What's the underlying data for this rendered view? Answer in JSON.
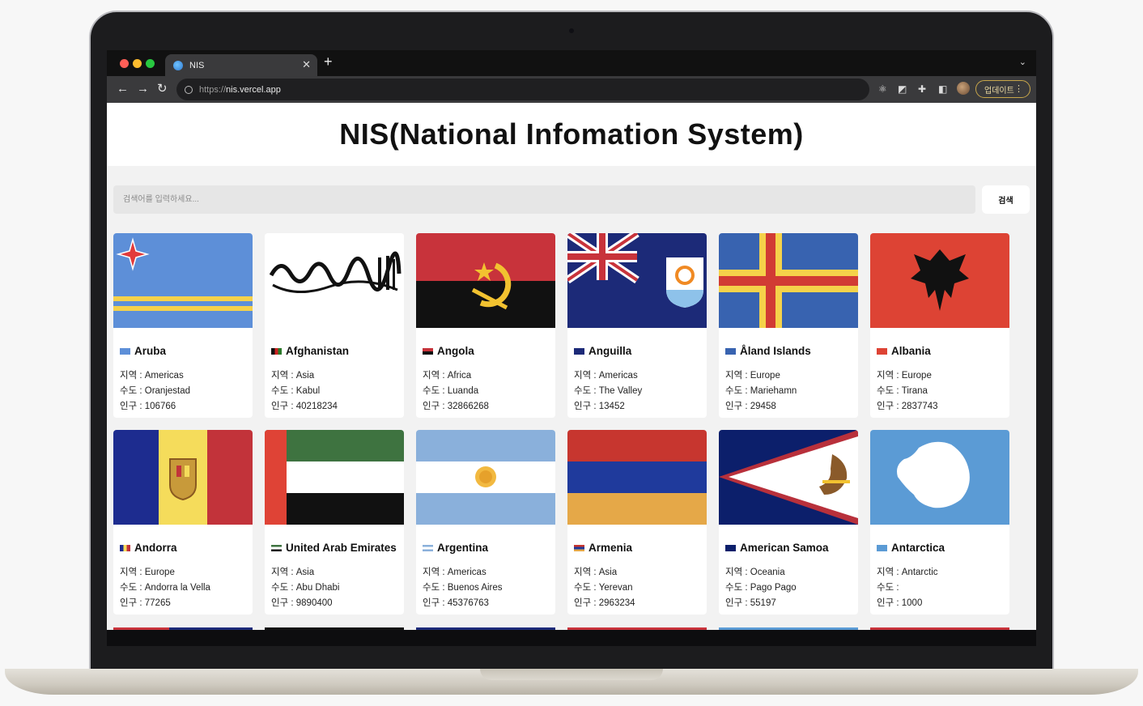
{
  "browser": {
    "tab_title": "NIS",
    "url_scheme": "https://",
    "url_host": "nis.vercel.app",
    "update_label": "업데이트"
  },
  "page": {
    "title": "NIS(National Infomation System)",
    "search_placeholder": "검색어를 입력하세요...",
    "search_button": "검색"
  },
  "labels": {
    "region": "지역",
    "capital": "수도",
    "population": "인구"
  },
  "countries": [
    {
      "name": "Aruba",
      "region": "Americas",
      "capital": "Oranjestad",
      "population": "106766"
    },
    {
      "name": "Afghanistan",
      "region": "Asia",
      "capital": "Kabul",
      "population": "40218234"
    },
    {
      "name": "Angola",
      "region": "Africa",
      "capital": "Luanda",
      "population": "32866268"
    },
    {
      "name": "Anguilla",
      "region": "Americas",
      "capital": "The Valley",
      "population": "13452"
    },
    {
      "name": "Åland Islands",
      "region": "Europe",
      "capital": "Mariehamn",
      "population": "29458"
    },
    {
      "name": "Albania",
      "region": "Europe",
      "capital": "Tirana",
      "population": "2837743"
    },
    {
      "name": "Andorra",
      "region": "Europe",
      "capital": "Andorra la Vella",
      "population": "77265"
    },
    {
      "name": "United Arab Emirates",
      "region": "Asia",
      "capital": "Abu Dhabi",
      "population": "9890400"
    },
    {
      "name": "Argentina",
      "region": "Americas",
      "capital": "Buenos Aires",
      "population": "45376763"
    },
    {
      "name": "Armenia",
      "region": "Asia",
      "capital": "Yerevan",
      "population": "2963234"
    },
    {
      "name": "American Samoa",
      "region": "Oceania",
      "capital": "Pago Pago",
      "population": "55197"
    },
    {
      "name": "Antarctica",
      "region": "Antarctic",
      "capital": "",
      "population": "1000"
    }
  ]
}
